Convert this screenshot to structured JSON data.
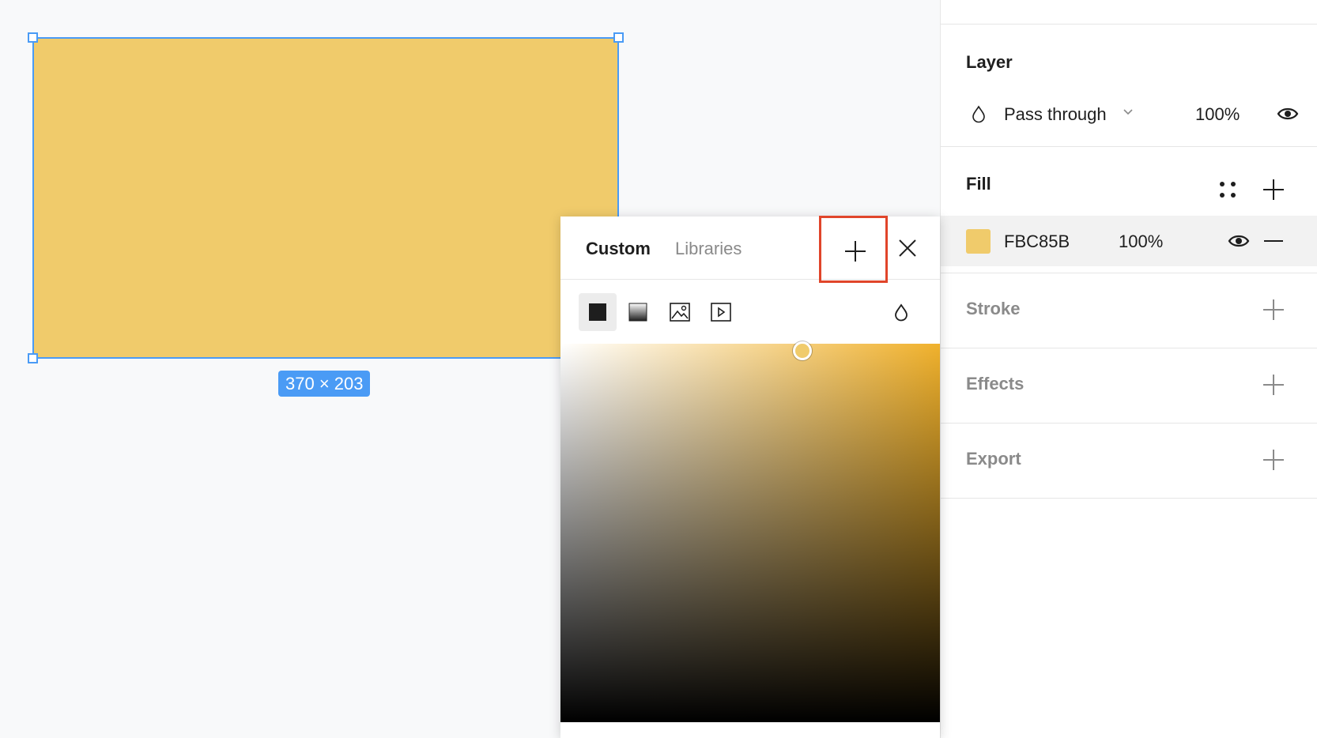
{
  "canvas": {
    "dimension_label": "370 × 203",
    "shape_color": "#F0CB6B",
    "selection_color": "#4A9BF5"
  },
  "panel": {
    "layer": {
      "title": "Layer",
      "blend_mode": "Pass through",
      "opacity": "100%",
      "blend_icon": "drop-icon",
      "visibility_icon": "eye-icon"
    },
    "fill": {
      "title": "Fill",
      "hex": "FBC85B",
      "opacity": "100%",
      "swatch_color": "#F0CB6B",
      "styles_icon": "style-grid-icon",
      "add_icon": "plus-icon",
      "remove_icon": "minus-icon"
    },
    "stroke": {
      "title": "Stroke"
    },
    "effects": {
      "title": "Effects"
    },
    "export": {
      "title": "Export"
    }
  },
  "picker": {
    "tabs": [
      "Custom",
      "Libraries"
    ],
    "active_tab": "Custom",
    "fill_types": [
      "solid",
      "gradient",
      "image",
      "video"
    ],
    "eyedropper_icon": "drop-icon",
    "hue_color": "#F0B12C",
    "highlight_color": "#E0452A"
  }
}
